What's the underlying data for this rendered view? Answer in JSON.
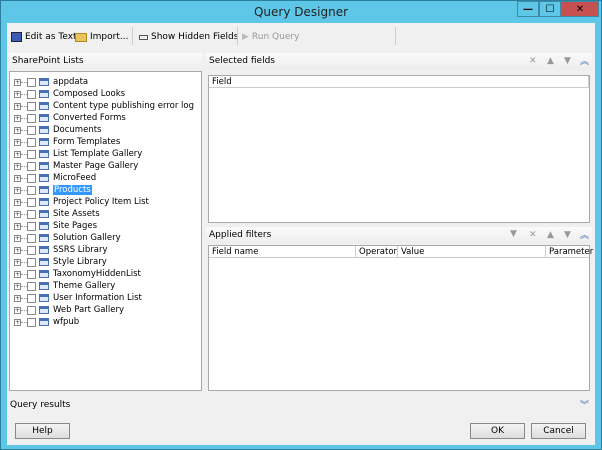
{
  "window": {
    "title": "Query Designer",
    "minimize": "—",
    "maximize": "☐",
    "close": "✕"
  },
  "toolbar": {
    "edit_as_text": "Edit as Text",
    "import": "Import...",
    "show_hidden_fields": "Show Hidden Fields",
    "run_query": "Run Query"
  },
  "left_panel": {
    "title": "SharePoint Lists",
    "selected": "Products",
    "items": [
      "appdata",
      "Composed Looks",
      "Content type publishing error log",
      "Converted Forms",
      "Documents",
      "Form Templates",
      "List Template Gallery",
      "Master Page Gallery",
      "MicroFeed",
      "Products",
      "Project Policy Item List",
      "Site Assets",
      "Site Pages",
      "Solution Gallery",
      "SSRS Library",
      "Style Library",
      "TaxonomyHiddenList",
      "Theme Gallery",
      "User Information List",
      "Web Part Gallery",
      "wfpub"
    ]
  },
  "selected_fields": {
    "title": "Selected fields",
    "columns": [
      "Field"
    ]
  },
  "applied_filters": {
    "title": "Applied filters",
    "columns": [
      "Field name",
      "Operator",
      "Value",
      "Parameter"
    ]
  },
  "query_results": {
    "title": "Query results"
  },
  "buttons": {
    "help": "Help",
    "ok": "OK",
    "cancel": "Cancel"
  },
  "icons": {
    "expand": "+",
    "delete": "✕",
    "up": "▲",
    "down": "▼",
    "collapse": "︽",
    "expand_section": "︾",
    "filter": "▼"
  }
}
